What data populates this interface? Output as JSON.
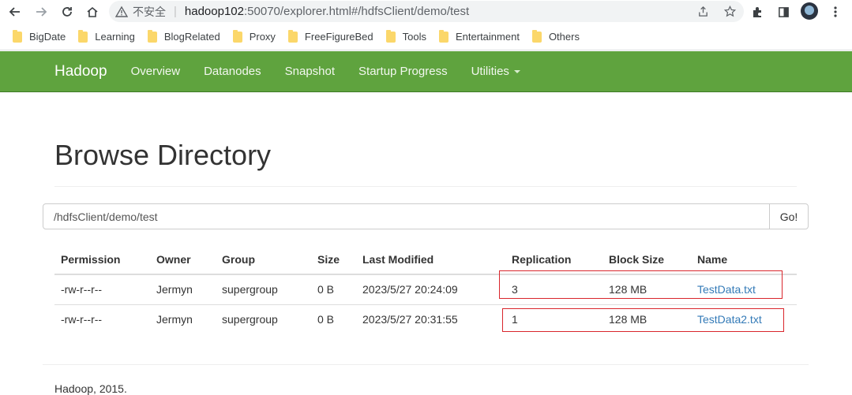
{
  "browser": {
    "insecure_label": "不安全",
    "url_host": "hadoop102",
    "url_path": ":50070/explorer.html#/hdfsClient/demo/test"
  },
  "bookmarks": [
    "BigDate",
    "Learning",
    "BlogRelated",
    "Proxy",
    "FreeFigureBed",
    "Tools",
    "Entertainment",
    "Others"
  ],
  "navbar": {
    "brand": "Hadoop",
    "links": [
      "Overview",
      "Datanodes",
      "Snapshot",
      "Startup Progress",
      "Utilities"
    ]
  },
  "page": {
    "title": "Browse Directory",
    "path_value": "/hdfsClient/demo/test",
    "go_label": "Go!"
  },
  "table": {
    "headers": [
      "Permission",
      "Owner",
      "Group",
      "Size",
      "Last Modified",
      "Replication",
      "Block Size",
      "Name"
    ],
    "rows": [
      [
        "-rw-r--r--",
        "Jermyn",
        "supergroup",
        "0 B",
        "2023/5/27 20:24:09",
        "3",
        "128 MB",
        "TestData.txt"
      ],
      [
        "-rw-r--r--",
        "Jermyn",
        "supergroup",
        "0 B",
        "2023/5/27 20:31:55",
        "1",
        "128 MB",
        "TestData2.txt"
      ]
    ]
  },
  "footer": "Hadoop, 2015.",
  "colors": {
    "navbar": "#5fa33e",
    "link": "#337ab7",
    "highlight_box": "#d9262c"
  }
}
